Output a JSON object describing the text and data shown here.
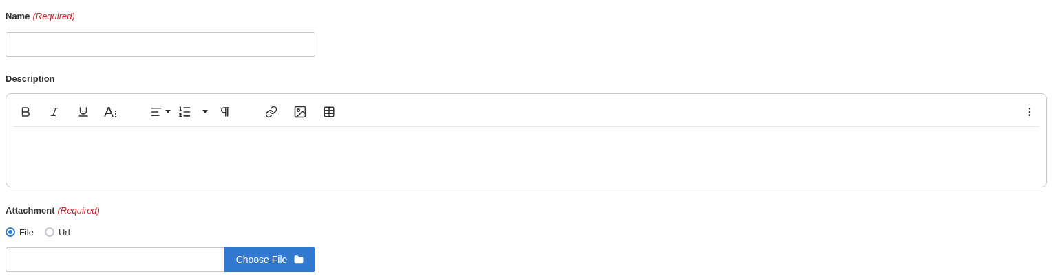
{
  "name_field": {
    "label": "Name",
    "required_note": "(Required)"
  },
  "description": {
    "label": "Description"
  },
  "attachment": {
    "label": "Attachment",
    "required_note": "(Required)",
    "options": [
      {
        "label": "File",
        "selected": true
      },
      {
        "label": "Url",
        "selected": false
      }
    ],
    "button": "Choose File"
  }
}
